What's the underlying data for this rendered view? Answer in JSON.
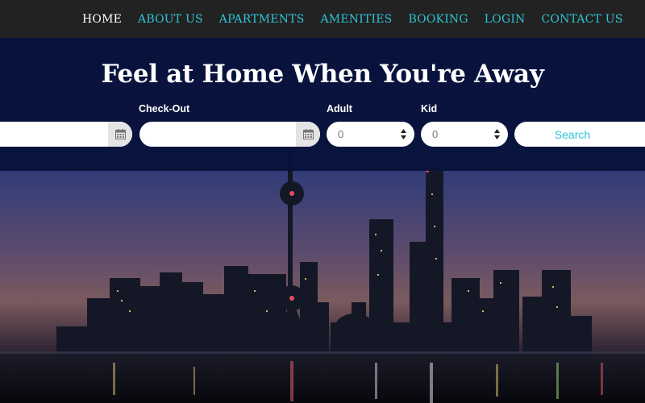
{
  "nav": {
    "items": [
      {
        "label": "HOME",
        "active": true
      },
      {
        "label": "ABOUT US",
        "active": false
      },
      {
        "label": "APARTMENTS",
        "active": false
      },
      {
        "label": "AMENITIES",
        "active": false
      },
      {
        "label": "BOOKING",
        "active": false
      },
      {
        "label": "LOGIN",
        "active": false
      },
      {
        "label": "CONTACT US",
        "active": false
      }
    ]
  },
  "hero": {
    "title": "Feel at Home When You're Away"
  },
  "booking_form": {
    "checkin": {
      "label": "",
      "value": "",
      "icon": "calendar-icon"
    },
    "checkout": {
      "label": "Check-Out",
      "value": "",
      "icon": "calendar-icon"
    },
    "adult": {
      "label": "Adult",
      "value": "0"
    },
    "kid": {
      "label": "Kid",
      "value": "0"
    },
    "search_label": "Search"
  },
  "colors": {
    "accent": "#2ec4d6",
    "navbar": "#222222",
    "overlay": "#07113a"
  }
}
